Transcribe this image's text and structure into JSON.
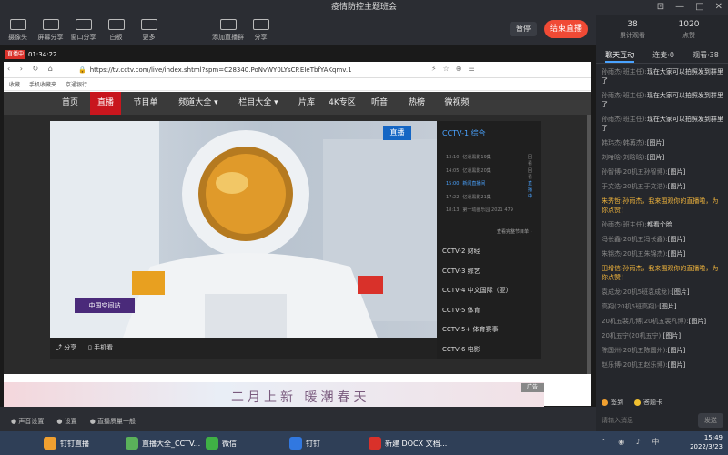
{
  "window": {
    "title": "疫情防控主题班会"
  },
  "toolbar": {
    "items": [
      {
        "label": "摄像头",
        "icon": "camera-icon"
      },
      {
        "label": "屏幕分享",
        "icon": "screen-share-icon"
      },
      {
        "label": "窗口分享",
        "icon": "window-share-icon"
      },
      {
        "label": "白板",
        "icon": "whiteboard-icon"
      },
      {
        "label": "更多",
        "icon": "more-icon"
      },
      {
        "label": "添加直播群",
        "icon": "add-group-icon"
      },
      {
        "label": "分享",
        "icon": "share-icon"
      }
    ],
    "pause_label": "暂停",
    "end_label": "结束直播"
  },
  "stats": {
    "views_total": "38",
    "views_total_label": "累计观看",
    "likes": "1020",
    "likes_label": "点赞"
  },
  "panel_tabs": [
    "聊天互动",
    "连麦·0",
    "观看·38"
  ],
  "chat": [
    {
      "user": "孙雨杰(班主任):",
      "text": "现在大家可以拍照发到群里了",
      "hl": false
    },
    {
      "user": "孙雨杰(班主任):",
      "text": "现在大家可以拍照发到群里了",
      "hl": false
    },
    {
      "user": "孙雨杰(班主任):",
      "text": "现在大家可以拍照发到群里了",
      "hl": false
    },
    {
      "user": "韩玮杰(韩苒杰):",
      "text": "[图片]",
      "hl": false
    },
    {
      "user": "刘哈晗(刘晗晗):",
      "text": "[图片]",
      "hl": false
    },
    {
      "user": "孙智博(20机五孙智博):",
      "text": "[图片]",
      "hl": false
    },
    {
      "user": "于文浩(20机五于文浩):",
      "text": "[图片]",
      "hl": false
    },
    {
      "user": "朱秀哲:",
      "text": "孙雨杰，我来围观你的直播啦，为你点赞！",
      "hl": true
    },
    {
      "user": "孙雨杰(班主任):",
      "text": "都看个脸",
      "hl": false
    },
    {
      "user": "冯长鑫(20机五冯长鑫):",
      "text": "[图片]",
      "hl": false
    },
    {
      "user": "朱锦杰(20机五朱锦杰):",
      "text": "[图片]",
      "hl": false
    },
    {
      "user": "田增信:",
      "text": "孙雨杰，我来围观你的直播啦，为你点赞！",
      "hl": true
    },
    {
      "user": "袁成龙(20机5班袁成龙):",
      "text": "[图片]",
      "hl": false
    },
    {
      "user": "高翔(20机5班高翔):",
      "text": "[图片]",
      "hl": false
    },
    {
      "user": "20机五裴凡博(20机五裴凡博):",
      "text": "[图片]",
      "hl": false
    },
    {
      "user": "20机五宁(20机五宁):",
      "text": "[图片]",
      "hl": false
    },
    {
      "user": "陈国州(20机五陈国州):",
      "text": "[图片]",
      "hl": false
    },
    {
      "user": "赵乐博(20机五赵乐博):",
      "text": "[图片]",
      "hl": false
    }
  ],
  "chat_actions": {
    "signin": "签到",
    "answer": "答题卡",
    "input_placeholder": "请输入消息",
    "send": "发送"
  },
  "live": {
    "badge": "直播中",
    "timer": "01:34:22"
  },
  "browser": {
    "url": "https://tv.cctv.com/live/index.shtml?spm=C28340.PoNvWY0LYsCP.EIeTbfYAKqmv.1",
    "bookmarks": [
      "收藏",
      "手机收藏夹",
      "京通银行"
    ]
  },
  "site_nav": [
    "首页",
    "直播",
    "节目单",
    "频道大全 ▾",
    "栏目大全 ▾",
    "片库",
    "4K专区",
    "听音",
    "热榜",
    "微视频"
  ],
  "video": {
    "badge": "直播",
    "logo": "中国空间站",
    "share": "分享",
    "mobile": "手机看"
  },
  "channels": {
    "title": "CCTV-1 综合",
    "programs": [
      {
        "time": "13:10",
        "name": "亿道黑影19集",
        "tag": "回看"
      },
      {
        "time": "14:05",
        "name": "亿道黑影20集",
        "tag": "回看"
      },
      {
        "time": "15:00",
        "name": "新闻直播间",
        "tag": "直播中"
      },
      {
        "time": "17:22",
        "name": "亿道黑影21集",
        "tag": ""
      },
      {
        "time": "18:13",
        "name": "第一动画乐园 2021 479",
        "tag": ""
      }
    ],
    "more": "查看完整节目单 ›",
    "list": [
      "CCTV-2 财经",
      "CCTV-3 综艺",
      "CCTV-4 中文国际（亚）",
      "CCTV-5 体育",
      "CCTV-5+ 体育赛事",
      "CCTV-6 电影"
    ]
  },
  "ad": {
    "text": "二月上新 暖潮春天",
    "label": "广告"
  },
  "bottom": [
    "声音设置",
    "设置",
    "直播质量一般"
  ],
  "taskbar": [
    {
      "label": "钉钉直播",
      "color": "#f0a030"
    },
    {
      "label": "直播大全_CCTV...",
      "color": "#5ab15a"
    },
    {
      "label": "微信",
      "color": "#3fb045"
    },
    {
      "label": "钉钉",
      "color": "#3178e0"
    },
    {
      "label": "新建 DOCX 文档...",
      "color": "#d9312a"
    }
  ],
  "clock": {
    "time": "15:49",
    "date": "2022/3/23"
  }
}
